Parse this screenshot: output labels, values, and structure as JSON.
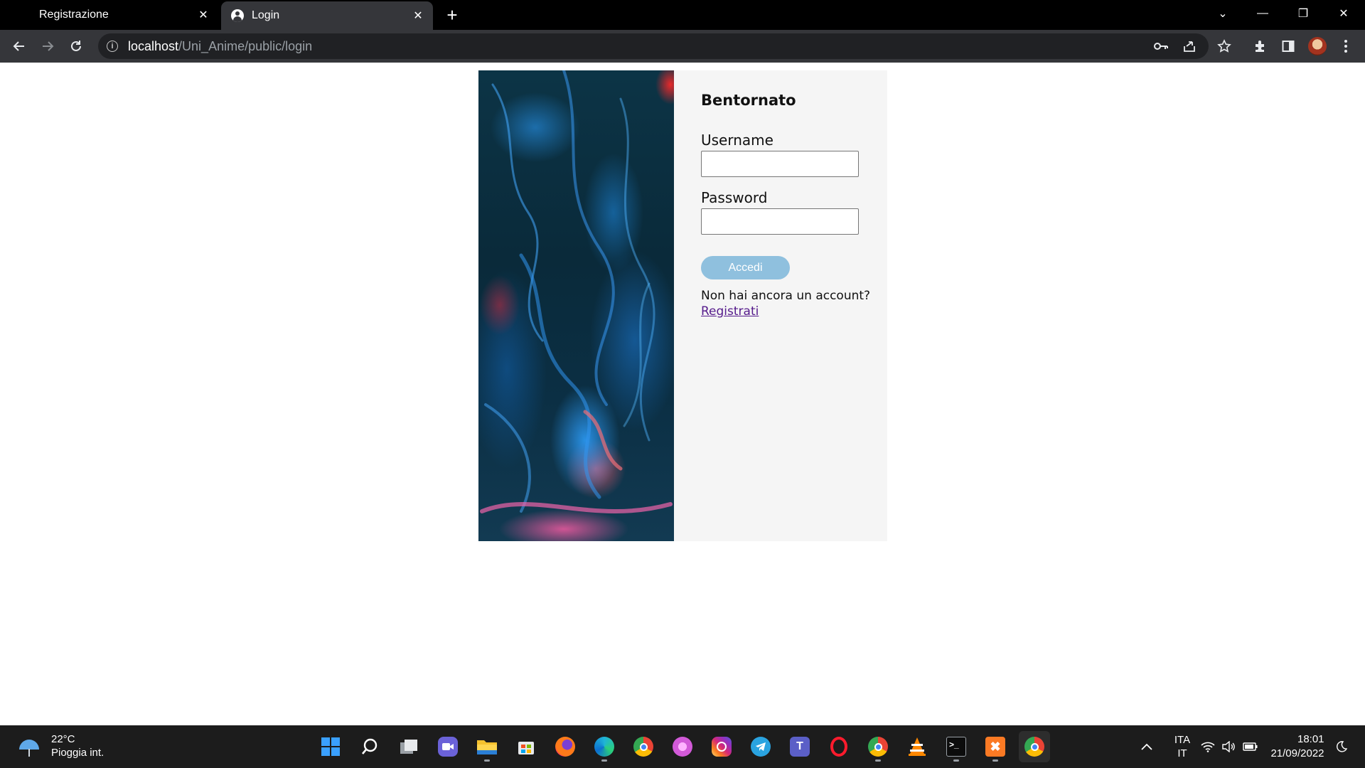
{
  "browser": {
    "tabs": [
      {
        "label": "Registrazione",
        "active": false
      },
      {
        "label": "Login",
        "active": true
      }
    ],
    "new_tab_symbol": "+",
    "close_symbol": "✕",
    "window_controls": {
      "tab_search": "⌄",
      "minimize": "—",
      "restore": "❐",
      "close": "✕"
    },
    "url": {
      "host": "localhost",
      "path": "/Uni_Anime/public/login"
    }
  },
  "login": {
    "title": "Bentornato",
    "username_label": "Username",
    "username_value": "",
    "password_label": "Password",
    "password_value": "",
    "submit_label": "Accedi",
    "signup_prompt": "Non hai ancora un account?",
    "signup_link": "Registrati"
  },
  "taskbar": {
    "weather": {
      "temperature": "22°C",
      "condition": "Pioggia int."
    },
    "apps": [
      "windows-start-icon",
      "search-icon",
      "task-view-icon",
      "chat-icon",
      "file-explorer-icon",
      "store-icon",
      "firefox-icon",
      "edge-icon",
      "chrome-icon",
      "pink-app-icon",
      "instagram-icon",
      "telegram-icon",
      "teams-icon",
      "opera-icon",
      "chrome-profile-icon",
      "vlc-icon",
      "terminal-icon",
      "xampp-icon",
      "chrome-active-icon"
    ],
    "language": {
      "line1": "ITA",
      "line2": "IT"
    },
    "clock": {
      "time": "18:01",
      "date": "21/09/2022"
    }
  },
  "colors": {
    "tab_strip": "#000000",
    "toolbar": "#35363a",
    "omnibox": "#202124",
    "form_panel": "#f5f5f5",
    "submit_button": "#8fc0de",
    "link": "#551a8b",
    "taskbar": "#1c1c1c"
  }
}
